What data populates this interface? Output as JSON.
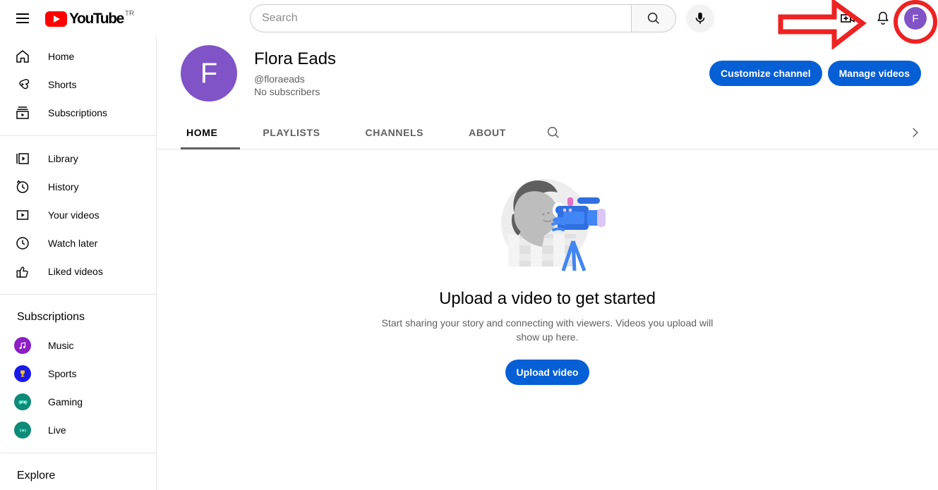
{
  "masthead": {
    "menu_icon": "hamburger-menu-icon",
    "logo_text": "YouTube",
    "logo_country_code": "TR",
    "search": {
      "placeholder": "Search",
      "value": "",
      "search_icon": "search-icon",
      "mic_icon": "microphone-icon"
    },
    "create_icon": "create-video-icon",
    "notifications_icon": "notification-bell-icon",
    "avatar_letter": "F",
    "avatar_color": "#8054c7"
  },
  "sidebar": {
    "primary": [
      {
        "label": "Home",
        "icon": "home-icon"
      },
      {
        "label": "Shorts",
        "icon": "shorts-icon"
      },
      {
        "label": "Subscriptions",
        "icon": "subscriptions-icon"
      }
    ],
    "library": [
      {
        "label": "Library",
        "icon": "library-icon"
      },
      {
        "label": "History",
        "icon": "history-icon"
      },
      {
        "label": "Your videos",
        "icon": "your-videos-icon"
      },
      {
        "label": "Watch later",
        "icon": "watch-later-icon"
      },
      {
        "label": "Liked videos",
        "icon": "liked-videos-icon"
      }
    ],
    "subscriptions_title": "Subscriptions",
    "subscriptions": [
      {
        "label": "Music",
        "icon": "music-note-icon",
        "color": "#8c1ec4"
      },
      {
        "label": "Sports",
        "icon": "trophy-icon",
        "color": "#1a1aee"
      },
      {
        "label": "Gaming",
        "icon": "gamepad-icon",
        "color": "#0e8a78"
      },
      {
        "label": "Live",
        "icon": "broadcast-icon",
        "color": "#0e8a78"
      }
    ],
    "explore_title": "Explore"
  },
  "channel": {
    "avatar_letter": "F",
    "name": "Flora Eads",
    "handle": "@floraeads",
    "subscribers": "No subscribers",
    "customize_button": "Customize channel",
    "manage_button": "Manage videos",
    "accent_color": "#065fd4"
  },
  "tabs": {
    "items": [
      {
        "label": "HOME",
        "active": true
      },
      {
        "label": "PLAYLISTS",
        "active": false
      },
      {
        "label": "CHANNELS",
        "active": false
      },
      {
        "label": "ABOUT",
        "active": false
      }
    ],
    "search_icon": "search-icon",
    "overflow_icon": "chevron-right-icon"
  },
  "empty_state": {
    "illustration": "person-with-video-camera-illustration",
    "title": "Upload a video to get started",
    "subtitle": "Start sharing your story and connecting with viewers. Videos you upload will show up here.",
    "button_label": "Upload video"
  },
  "annotation": {
    "arrow": "red-arrow-pointing-right",
    "highlight": "red-circle-around-avatar",
    "color": "#ee2222"
  }
}
